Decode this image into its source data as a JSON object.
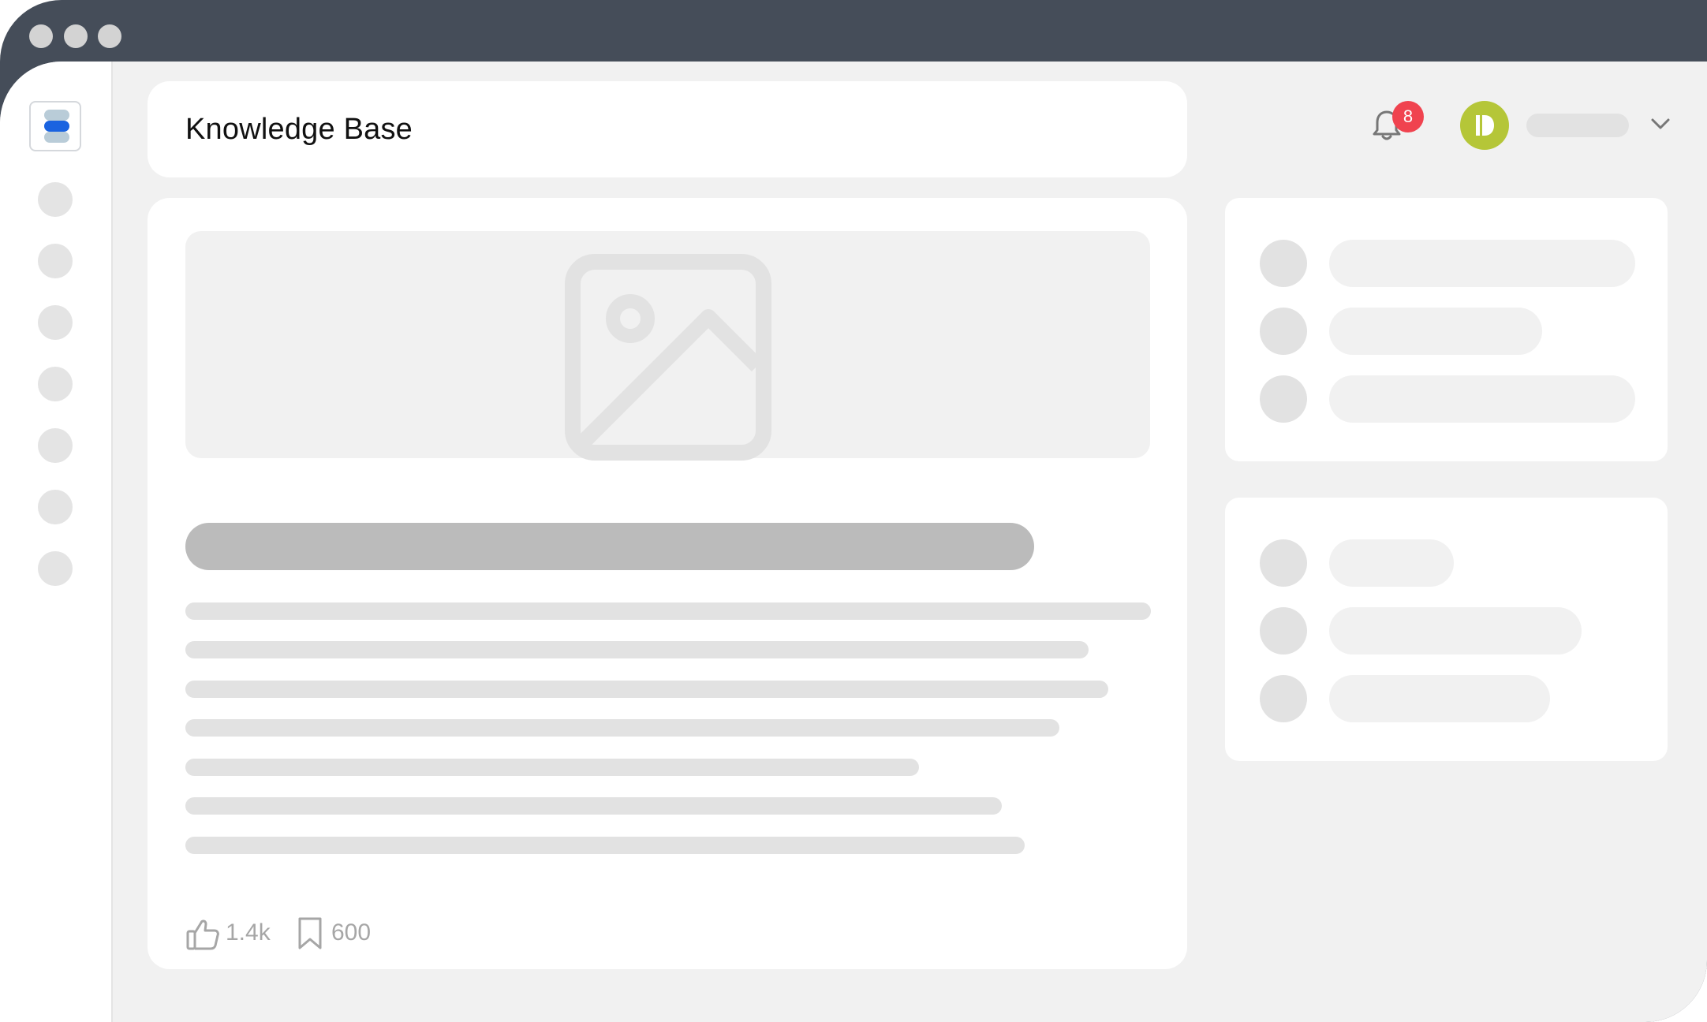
{
  "window": {
    "frame_color": "#454d59",
    "traffic_lights": [
      "window-dot",
      "window-dot",
      "window-dot"
    ]
  },
  "sidebar": {
    "logo_icon": "stack-logo-icon",
    "logo_colors": [
      "#b9ccd8",
      "#1a63e0",
      "#b9ccd8"
    ],
    "nav_items": [
      "nav-item",
      "nav-item",
      "nav-item",
      "nav-item",
      "nav-item",
      "nav-item",
      "nav-item"
    ]
  },
  "header": {
    "title": "Knowledge Base",
    "notifications": {
      "icon": "bell-icon",
      "count": "8",
      "badge_color": "#f0434f"
    },
    "user": {
      "avatar_color": "#b5c638",
      "menu_icon": "chevron-down-icon"
    }
  },
  "article": {
    "hero_icon": "image-placeholder-icon",
    "likes": {
      "icon": "thumbs-up-icon",
      "count": "1.4k"
    },
    "bookmarks": {
      "icon": "bookmark-icon",
      "count": "600"
    }
  },
  "right_panels": [
    {
      "rows": 3
    },
    {
      "rows": 3
    }
  ]
}
